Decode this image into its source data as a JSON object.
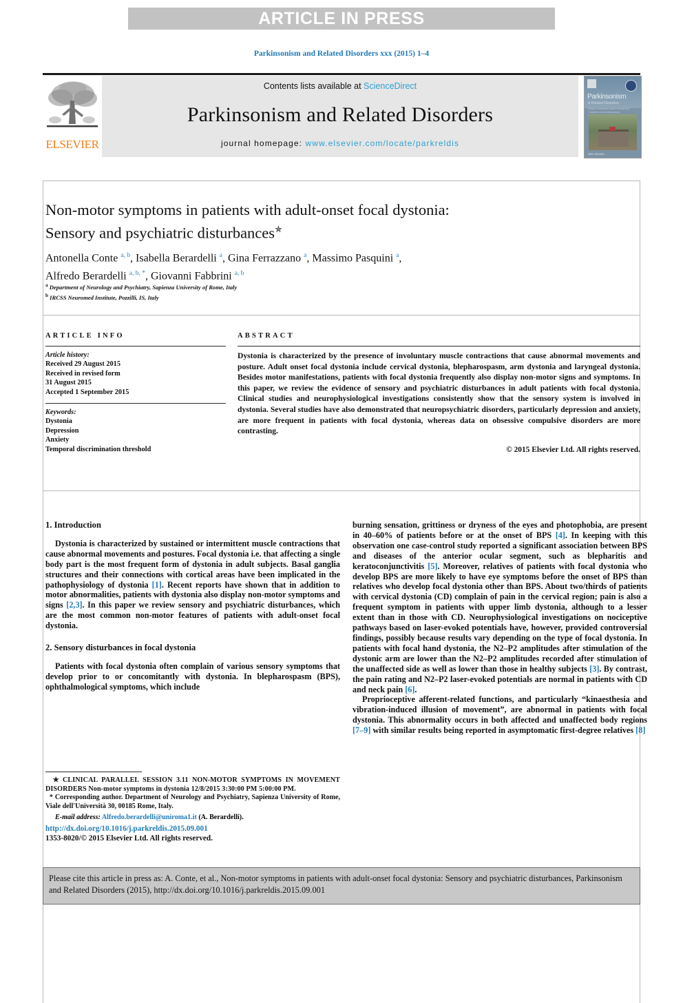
{
  "banner": {
    "text": "ARTICLE IN PRESS"
  },
  "running_head": "Parkinsonism and Related Disorders xxx (2015) 1–4",
  "masthead": {
    "contents_prefix": "Contents lists available at ",
    "sciencedirect": "ScienceDirect",
    "journal_name": "Parkinsonism and Related Disorders",
    "homepage_label": "journal homepage:",
    "homepage_url": "www.elsevier.com/locate/parkreldis",
    "publisher_logo_text": "ELSEVIER",
    "cover": {
      "title": "Parkinsonism",
      "subtitle": "& Related Disorders",
      "blurb": "Clinical Correlations, Basic Science and Translation for Interdisciplinary Neuroscientists",
      "footer": "ISSN 1353-8020"
    },
    "link_color": "#2f9fd0"
  },
  "article": {
    "title_line1": "Non-motor symptoms in patients with adult-onset focal dystonia:",
    "title_line2": "Sensory and psychiatric disturbances",
    "title_marker": "✯",
    "authors": [
      {
        "name": "Antonella Conte",
        "sup": "a, b",
        "sep": ", "
      },
      {
        "name": "Isabella Berardelli",
        "sup": "a",
        "sep": ", "
      },
      {
        "name": "Gina Ferrazzano",
        "sup": "a",
        "sep": ", "
      },
      {
        "name": "Massimo Pasquini",
        "sup": "a",
        "sep": ", "
      },
      {
        "name": "Alfredo Berardelli",
        "sup": "a, b, *",
        "sep": ", "
      },
      {
        "name": "Giovanni Fabbrini",
        "sup": "a, b",
        "sep": ""
      }
    ],
    "affiliations": [
      {
        "mark": "a",
        "text": "Department of Neurology and Psychiatry, Sapienza University of Rome, Italy"
      },
      {
        "mark": "b",
        "text": "IRCSS Neuromed Institute, Pozzilli, IS, Italy"
      }
    ],
    "superscript_color": "#2f7fb5"
  },
  "article_info": {
    "heading": "ARTICLE INFO",
    "history_label": "Article history:",
    "history": [
      "Received 29 August 2015",
      "Received in revised form",
      "31 August 2015",
      "Accepted 1 September 2015"
    ],
    "keywords_label": "Keywords:",
    "keywords": [
      "Dystonia",
      "Depression",
      "Anxiety",
      "Temporal discrimination threshold"
    ]
  },
  "abstract": {
    "heading": "ABSTRACT",
    "body": "Dystonia is characterized by the presence of involuntary muscle contractions that cause abnormal movements and posture. Adult onset focal dystonia include cervical dystonia, blepharospasm, arm dystonia and laryngeal dystonia. Besides motor manifestations, patients with focal dystonia frequently also display non-motor signs and symptoms. In this paper, we review the evidence of sensory and psychiatric disturbances in adult patients with focal dystonia. Clinical studies and neurophysiological investigations consistently show that the sensory system is involved in dystonia. Several studies have also demonstrated that neuropsychiatric disorders, particularly depression and anxiety, are more frequent in patients with focal dystonia, whereas data on obsessive compulsive disorders are more contrasting.",
    "copyright": "© 2015 Elsevier Ltd. All rights reserved."
  },
  "body": {
    "left_column": {
      "section1_heading": "1. Introduction",
      "p1_a": "Dystonia is characterized by sustained or intermittent muscle contractions that cause abnormal movements and postures. Focal dystonia i.e. that affecting a single body part is the most frequent form of dystonia in adult subjects. Basal ganglia structures and their connections with cortical areas have been implicated in the pathophysiology of dystonia ",
      "p1_ref1": "[1]",
      "p1_b": ". Recent reports have shown that in addition to motor abnormalities, patients with dystonia also display non-motor symptoms and signs ",
      "p1_ref2": "[2,3]",
      "p1_c": ". In this paper we review sensory and psychiatric disturbances, which are the most common non-motor features of patients with adult-onset focal dystonia.",
      "section2_heading": "2. Sensory disturbances in focal dystonia",
      "p2": "Patients with focal dystonia often complain of various sensory symptoms that develop prior to or concomitantly with dystonia. In blepharospasm (BPS), ophthalmological symptoms, which include"
    },
    "right_column": {
      "p3_a": "burning sensation, grittiness or dryness of the eyes and photophobia, are present in 40–60% of patients before or at the onset of BPS ",
      "p3_ref4": "[4]",
      "p3_b": ". In keeping with this observation one case-control study reported a significant association between BPS and diseases of the anterior ocular segment, such as blepharitis and keratoconjunctivitis ",
      "p3_ref5": "[5]",
      "p3_c": ". Moreover, relatives of patients with focal dystonia who develop BPS are more likely to have eye symptoms before the onset of BPS than relatives who develop focal dystonia other than BPS. About two/thirds of patients with cervical dystonia (CD) complain of pain in the cervical region; pain is also a frequent symptom in patients with upper limb dystonia, although to a lesser extent than in those with CD. Neurophysiological investigations on nociceptive pathways based on laser-evoked potentials have, however, provided controversial findings, possibly because results vary depending on the type of focal dystonia. In patients with focal hand dystonia, the N2–P2 amplitudes after stimulation of the dystonic arm are lower than the N2–P2 amplitudes recorded after stimulation of the unaffected side as well as lower than those in healthy subjects ",
      "p3_ref3": "[3]",
      "p3_d": ". By contrast, the pain rating and N2–P2 laser-evoked potentials are normal in patients with CD and neck pain ",
      "p3_ref6": "[6]",
      "p3_e": ".",
      "p4_a": "Proprioceptive afferent-related functions, and particularly “kinaesthesia and vibration-induced illusion of movement”, are abnormal in patients with focal dystonia. This abnormality occurs in both affected and unaffected body regions ",
      "p4_ref79": "[7–9]",
      "p4_b": " with similar results being reported in asymptomatic first-degree relatives ",
      "p4_ref8": "[8]"
    },
    "reference_color": "#1f7bb6"
  },
  "footnotes": {
    "star_mark": "✯",
    "star_text": "CLINICAL PARALLEL SESSION 3.11 NON-MOTOR SYMPTOMS IN MOVEMENT DISORDERS Non-motor symptoms in dystonia 12/8/2015 3:30:00 PM 5:00:00 PM.",
    "corr_mark": "*",
    "corr_text": "Corresponding author. Department of Neurology and Psychiatry, Sapienza University of Rome, Viale dell'Università 30, 00185 Rome, Italy.",
    "email_label": "E-mail address:",
    "email": "Alfredo.berardelli@uniroma1.it",
    "email_attrib": "(A. Berardelli)."
  },
  "doi_block": {
    "doi_url": "http://dx.doi.org/10.1016/j.parkreldis.2015.09.001",
    "issn_line": "1353-8020/© 2015 Elsevier Ltd. All rights reserved."
  },
  "cite_footer": {
    "text": "Please cite this article in press as: A. Conte, et al., Non-motor symptoms in patients with adult-onset focal dystonia: Sensory and psychiatric disturbances, Parkinsonism and Related Disorders (2015), http://dx.doi.org/10.1016/j.parkreldis.2015.09.001"
  }
}
